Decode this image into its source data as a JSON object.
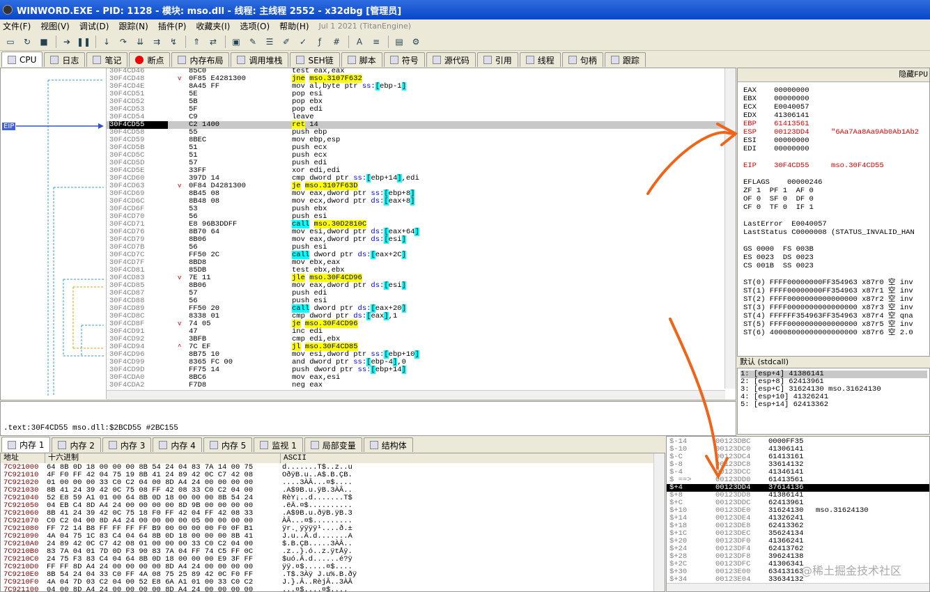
{
  "window": {
    "title": "WINWORD.EXE - PID: 1128 - 模块: mso.dll - 线程: 主线程 2552 - x32dbg [管理员]"
  },
  "menu": {
    "items": [
      "文件(F)",
      "视图(V)",
      "调试(D)",
      "跟踪(N)",
      "插件(P)",
      "收藏夹(I)",
      "选项(O)",
      "帮助(H)"
    ],
    "version": "Jul 1 2021 (TitanEngine)"
  },
  "tabs": [
    "CPU",
    "日志",
    "笔记",
    "断点",
    "内存布局",
    "调用堆栈",
    "SEH链",
    "脚本",
    "符号",
    "源代码",
    "引用",
    "线程",
    "句柄",
    "跟踪"
  ],
  "disasm": [
    {
      "addr": "30F4CD46",
      "bytes": "85C0",
      "instr": "test eax,eax"
    },
    {
      "addr": "30F4CD48",
      "bytes": "0F85 E4281300",
      "instr": "jne mso.3107F632",
      "kind": "jmp",
      "mark": "v"
    },
    {
      "addr": "30F4CD4E",
      "bytes": "8A45 FF",
      "instr": "mov al,byte ptr ss:[ebp-1]"
    },
    {
      "addr": "30F4CD51",
      "bytes": "5E",
      "instr": "pop esi"
    },
    {
      "addr": "30F4CD52",
      "bytes": "5B",
      "instr": "pop ebx"
    },
    {
      "addr": "30F4CD53",
      "bytes": "5F",
      "instr": "pop edi"
    },
    {
      "addr": "30F4CD54",
      "bytes": "C9",
      "instr": "leave"
    },
    {
      "addr": "30F4CD55",
      "bytes": "C2 1400",
      "instr": "ret 14",
      "kind": "ret",
      "cur": true
    },
    {
      "addr": "30F4CD58",
      "bytes": "55",
      "instr": "push ebp"
    },
    {
      "addr": "30F4CD59",
      "bytes": "8BEC",
      "instr": "mov ebp,esp"
    },
    {
      "addr": "30F4CD5B",
      "bytes": "51",
      "instr": "push ecx"
    },
    {
      "addr": "30F4CD5C",
      "bytes": "51",
      "instr": "push ecx"
    },
    {
      "addr": "30F4CD5D",
      "bytes": "57",
      "instr": "push edi"
    },
    {
      "addr": "30F4CD5E",
      "bytes": "33FF",
      "instr": "xor edi,edi"
    },
    {
      "addr": "30F4CD60",
      "bytes": "397D 14",
      "instr": "cmp dword ptr ss:[ebp+14],edi"
    },
    {
      "addr": "30F4CD63",
      "bytes": "0F84 D4281300",
      "instr": "je mso.3107F63D",
      "kind": "jmp",
      "mark": "v"
    },
    {
      "addr": "30F4CD69",
      "bytes": "8B45 08",
      "instr": "mov eax,dword ptr ss:[ebp+8]"
    },
    {
      "addr": "30F4CD6C",
      "bytes": "8B48 08",
      "instr": "mov ecx,dword ptr ds:[eax+8]"
    },
    {
      "addr": "30F4CD6F",
      "bytes": "53",
      "instr": "push ebx"
    },
    {
      "addr": "30F4CD70",
      "bytes": "56",
      "instr": "push esi"
    },
    {
      "addr": "30F4CD71",
      "bytes": "E8 96B3DDFF",
      "instr": "call mso.30D2810C",
      "kind": "call"
    },
    {
      "addr": "30F4CD76",
      "bytes": "8B70 64",
      "instr": "mov esi,dword ptr ds:[eax+64]"
    },
    {
      "addr": "30F4CD79",
      "bytes": "8B06",
      "instr": "mov eax,dword ptr ds:[esi]"
    },
    {
      "addr": "30F4CD7B",
      "bytes": "56",
      "instr": "push esi"
    },
    {
      "addr": "30F4CD7C",
      "bytes": "FF50 2C",
      "instr": "call dword ptr ds:[eax+2C]",
      "kind": "calli"
    },
    {
      "addr": "30F4CD7F",
      "bytes": "8BD8",
      "instr": "mov ebx,eax"
    },
    {
      "addr": "30F4CD81",
      "bytes": "85DB",
      "instr": "test ebx,ebx"
    },
    {
      "addr": "30F4CD83",
      "bytes": "7E 11",
      "instr": "jle mso.30F4CD96",
      "kind": "jmp",
      "mark": "v"
    },
    {
      "addr": "30F4CD85",
      "bytes": "8B06",
      "instr": "mov eax,dword ptr ds:[esi]"
    },
    {
      "addr": "30F4CD87",
      "bytes": "57",
      "instr": "push edi"
    },
    {
      "addr": "30F4CD88",
      "bytes": "56",
      "instr": "push esi"
    },
    {
      "addr": "30F4CD89",
      "bytes": "FF50 20",
      "instr": "call dword ptr ds:[eax+20]",
      "kind": "calli"
    },
    {
      "addr": "30F4CD8C",
      "bytes": "8338 01",
      "instr": "cmp dword ptr ds:[eax],1"
    },
    {
      "addr": "30F4CD8F",
      "bytes": "74 05",
      "instr": "je mso.30F4CD96",
      "kind": "jmp",
      "mark": "v"
    },
    {
      "addr": "30F4CD91",
      "bytes": "47",
      "instr": "inc edi"
    },
    {
      "addr": "30F4CD92",
      "bytes": "3BFB",
      "instr": "cmp edi,ebx"
    },
    {
      "addr": "30F4CD94",
      "bytes": "7C EF",
      "instr": "jl mso.30F4CD85",
      "kind": "jmp",
      "mark": "^"
    },
    {
      "addr": "30F4CD96",
      "bytes": "8B75 10",
      "instr": "mov esi,dword ptr ss:[ebp+10]"
    },
    {
      "addr": "30F4CD99",
      "bytes": "8365 FC 00",
      "instr": "and dword ptr ss:[ebp-4],0"
    },
    {
      "addr": "30F4CD9D",
      "bytes": "FF75 14",
      "instr": "push dword ptr ss:[ebp+14]"
    },
    {
      "addr": "30F4CDA0",
      "bytes": "8BC6",
      "instr": "mov eax,esi"
    },
    {
      "addr": "30F4CDA2",
      "bytes": "F7D8",
      "instr": "neg eax"
    }
  ],
  "eip_label": "EIP",
  "info_text": ".text:30F4CD55 mso.dll:$2BCD55 #2BC155",
  "registers": {
    "header": "隐藏FPU",
    "lines": [
      {
        "t": "EAX    00000000"
      },
      {
        "t": "EBX    00000000"
      },
      {
        "t": "ECX    E0040057"
      },
      {
        "t": "EDX    41306141"
      },
      {
        "t": "EBP    61413561",
        "red": true
      },
      {
        "t": "ESP    00123DD4     \"6Aa7Aa8Aa9Ab0Ab1Ab2",
        "red": true
      },
      {
        "t": "ESI    00000000"
      },
      {
        "t": "EDI    00000000"
      },
      {
        "t": ""
      },
      {
        "t": "EIP    30F4CD55     mso.30F4CD55",
        "red": true
      },
      {
        "t": ""
      },
      {
        "t": "EFLAGS    00000246"
      },
      {
        "t": "ZF 1  PF 1  AF 0"
      },
      {
        "t": "OF 0  SF 0  DF 0"
      },
      {
        "t": "CF 0  TF 0  IF 1"
      },
      {
        "t": ""
      },
      {
        "t": "LastError  E0040057"
      },
      {
        "t": "LastStatus C0000008 (STATUS_INVALID_HAN"
      },
      {
        "t": ""
      },
      {
        "t": "GS 0000  FS 003B"
      },
      {
        "t": "ES 0023  DS 0023"
      },
      {
        "t": "CS 001B  SS 0023"
      },
      {
        "t": ""
      },
      {
        "t": "ST(0) FFFF00000000FF354963 x87r0 空 inv"
      },
      {
        "t": "ST(1) FFFF00000000FF354963 x87r1 空 inv"
      },
      {
        "t": "ST(2) FFFF0000000000000000 x87r2 空 inv"
      },
      {
        "t": "ST(3) FFFF0000000000000000 x87r3 空 inv"
      },
      {
        "t": "ST(4) FFFFFF354963FF354963 x87r4 空 qna"
      },
      {
        "t": "ST(5) FFFF0000000000000000 x87r5 空 inv"
      },
      {
        "t": "ST(6) 40008000000000000000 x87r6 空 2.0"
      }
    ]
  },
  "call_convention": "默认 (stdcall)",
  "stack_args": [
    "1: [esp+4] 41386141",
    "2: [esp+8] 62413961",
    "3: [esp+C] 31624130 mso.31624130",
    "4: [esp+10] 41326241",
    "5: [esp+14] 62413362"
  ],
  "dump_tabs": [
    "内存 1",
    "内存 2",
    "内存 3",
    "内存 4",
    "内存 5",
    "监视 1",
    "局部变量",
    "结构体"
  ],
  "dump_headers": {
    "addr": "地址",
    "hex": "十六进制",
    "ascii": "ASCII"
  },
  "dump": [
    {
      "a": "7C921000",
      "h": "64 8B 0D 18 00 00 00 8B 54 24 04 83 7A 14 00 75",
      "s": "d.......T$..z..u"
    },
    {
      "a": "7C921010",
      "h": "4F F0 FF 42 04 75 19 8B 41 24 89 42 0C C7 42 08",
      "s": "OðÿB.u..A$.B.ÇB."
    },
    {
      "a": "7C921020",
      "h": "01 00 00 00 33 C0 C2 04 00 8D A4 24 00 00 00 00",
      "s": "....3ÀÂ...¤$...."
    },
    {
      "a": "7C921030",
      "h": "8B 41 24 39 42 0C 75 08 FF 42 08 33 C0 C2 04 00",
      "s": ".A$9B.u.ÿB.3ÀÂ.."
    },
    {
      "a": "7C921040",
      "h": "52 E8 59 A1 01 00 64 8B 0D 18 00 00 00 8B 54 24",
      "s": "RèY¡..d.......T$"
    },
    {
      "a": "7C921050",
      "h": "04 EB C4 8D A4 24 00 00 00 00 8D 9B 00 00 00 00",
      "s": ".ëÄ.¤$.........."
    },
    {
      "a": "7C921060",
      "h": "8B 41 24 39 42 0C 75 18 F0 FF 42 04 FF 42 08 33",
      "s": ".A$9B.u.ðÿB.ÿB.3"
    },
    {
      "a": "7C921070",
      "h": "C0 C2 04 00 8D A4 24 00 00 00 00 05 00 00 00 00",
      "s": "ÀÂ...¤$........."
    },
    {
      "a": "7C921080",
      "h": "FF 72 14 B8 FF FF FF FF B9 00 00 00 00 F0 0F B1",
      "s": "ÿr.¸ÿÿÿÿ¹....ð.±"
    },
    {
      "a": "7C921090",
      "h": "4A 04 75 1C 83 C4 04 64 8B 0D 18 00 00 00 8B 41",
      "s": "J.u..Ä.d.......A"
    },
    {
      "a": "7C9210A0",
      "h": "24 89 42 0C C7 42 08 01 00 00 00 33 C0 C2 04 00",
      "s": "$.B.ÇB.....3ÀÂ.."
    },
    {
      "a": "7C9210B0",
      "h": "83 7A 04 01 7D 0D F3 90 83 7A 04 FF 74 C5 FF 0C",
      "s": ".z..}.ó..z.ÿtÅÿ."
    },
    {
      "a": "7C9210C0",
      "h": "24 75 F3 83 C4 04 64 8B 0D 18 00 00 00 E9 3F FF",
      "s": "$uó.Ä.d......é?ÿ"
    },
    {
      "a": "7C9210D0",
      "h": "FF FF 8D A4 24 00 00 00 00 8D A4 24 00 00 00 00",
      "s": "ÿÿ.¤$.....¤$...."
    },
    {
      "a": "7C9210E0",
      "h": "8B 54 24 04 33 C0 FF 4A 08 75 25 89 42 0C F0 FF",
      "s": ".T$.3Àÿ J.u%.B.ðÿ"
    },
    {
      "a": "7C9210F0",
      "h": "4A 04 7D 03 C2 04 00 52 E8 6A A1 01 00 33 C0 C2",
      "s": "J.}.Â..RèjÂ..3ÀÂ"
    },
    {
      "a": "7C921100",
      "h": "04 00 8D A4 24 00 00 00 00 8D A4 24 00 00 00 00",
      "s": "...¤$....¤$...."
    }
  ],
  "stack": [
    {
      "o": "$-14",
      "ad": "00123DBC",
      "v": "0000FF35",
      "c": ""
    },
    {
      "o": "$-10",
      "ad": "00123DC0",
      "v": "41306141",
      "c": ""
    },
    {
      "o": "$-C",
      "ad": "00123DC4",
      "v": "61413161",
      "c": ""
    },
    {
      "o": "$-8",
      "ad": "00123DC8",
      "v": "33614132",
      "c": ""
    },
    {
      "o": "$-4",
      "ad": "00123DCC",
      "v": "41346141",
      "c": ""
    },
    {
      "o": "$ ==>",
      "ad": "00123DD0",
      "v": "61413561",
      "c": ""
    },
    {
      "o": "$+4",
      "ad": "00123DD4",
      "v": "37614136",
      "c": "",
      "cur": true
    },
    {
      "o": "$+8",
      "ad": "00123DD8",
      "v": "41386141",
      "c": ""
    },
    {
      "o": "$+C",
      "ad": "00123DDC",
      "v": "62413961",
      "c": ""
    },
    {
      "o": "$+10",
      "ad": "00123DE0",
      "v": "31624130",
      "c": "mso.31624130"
    },
    {
      "o": "$+14",
      "ad": "00123DE4",
      "v": "41326241",
      "c": ""
    },
    {
      "o": "$+18",
      "ad": "00123DE8",
      "v": "62413362",
      "c": ""
    },
    {
      "o": "$+1C",
      "ad": "00123DEC",
      "v": "35624134",
      "c": ""
    },
    {
      "o": "$+20",
      "ad": "00123DF0",
      "v": "41366241",
      "c": ""
    },
    {
      "o": "$+24",
      "ad": "00123DF4",
      "v": "62413762",
      "c": ""
    },
    {
      "o": "$+28",
      "ad": "00123DF8",
      "v": "39624138",
      "c": ""
    },
    {
      "o": "$+2C",
      "ad": "00123DFC",
      "v": "41306341",
      "c": ""
    },
    {
      "o": "$+30",
      "ad": "00123E00",
      "v": "63413163",
      "c": ""
    },
    {
      "o": "$+34",
      "ad": "00123E04",
      "v": "33634132",
      "c": ""
    }
  ],
  "watermark": "@稀土掘金技术社区",
  "colors": {
    "title_bar": "#0a46c8",
    "jump_highlight": "#ffff00",
    "call_highlight": "#00ffff",
    "register_changed": "#e00000",
    "annotation_arrow": "#f06418"
  }
}
